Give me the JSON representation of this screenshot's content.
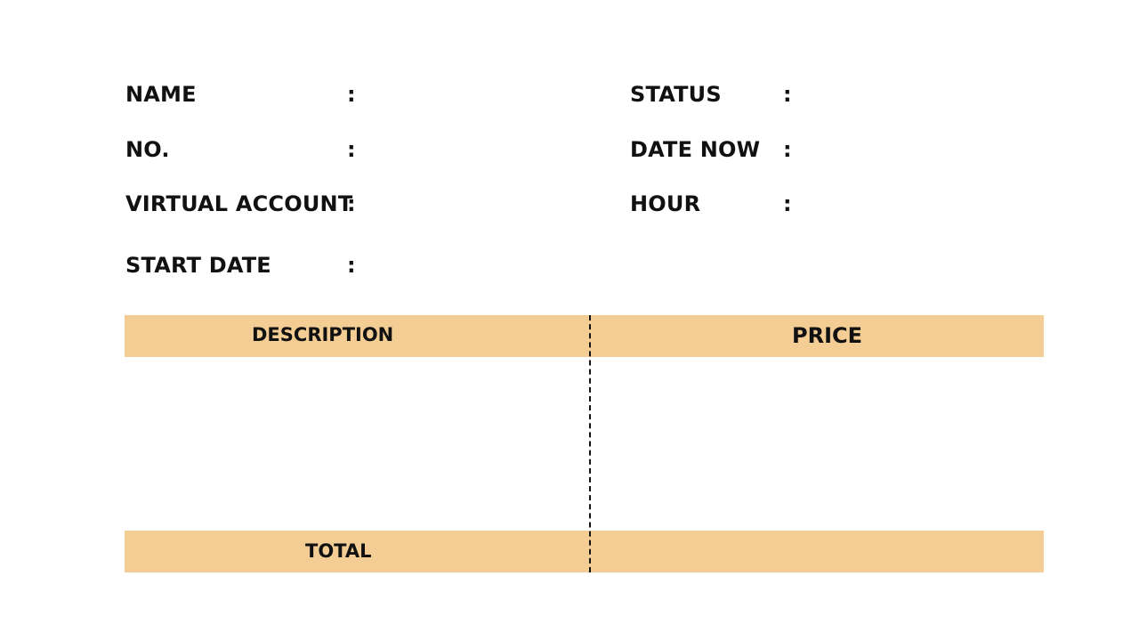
{
  "colors": {
    "band": "#f3cd93",
    "text": "#111111",
    "background": "#ffffff"
  },
  "fields_left": {
    "name_label": "NAME",
    "no_label": "NO.",
    "virtual_account_label": "VIRTUAL ACCOUNT",
    "start_date_label": "START DATE",
    "separator": ":"
  },
  "fields_right": {
    "status_label": "STATUS",
    "date_now_label": "DATE NOW",
    "hour_label": "HOUR",
    "separator": ":"
  },
  "table": {
    "description_header": "DESCRIPTION",
    "price_header": "PRICE",
    "total_label": "TOTAL"
  }
}
